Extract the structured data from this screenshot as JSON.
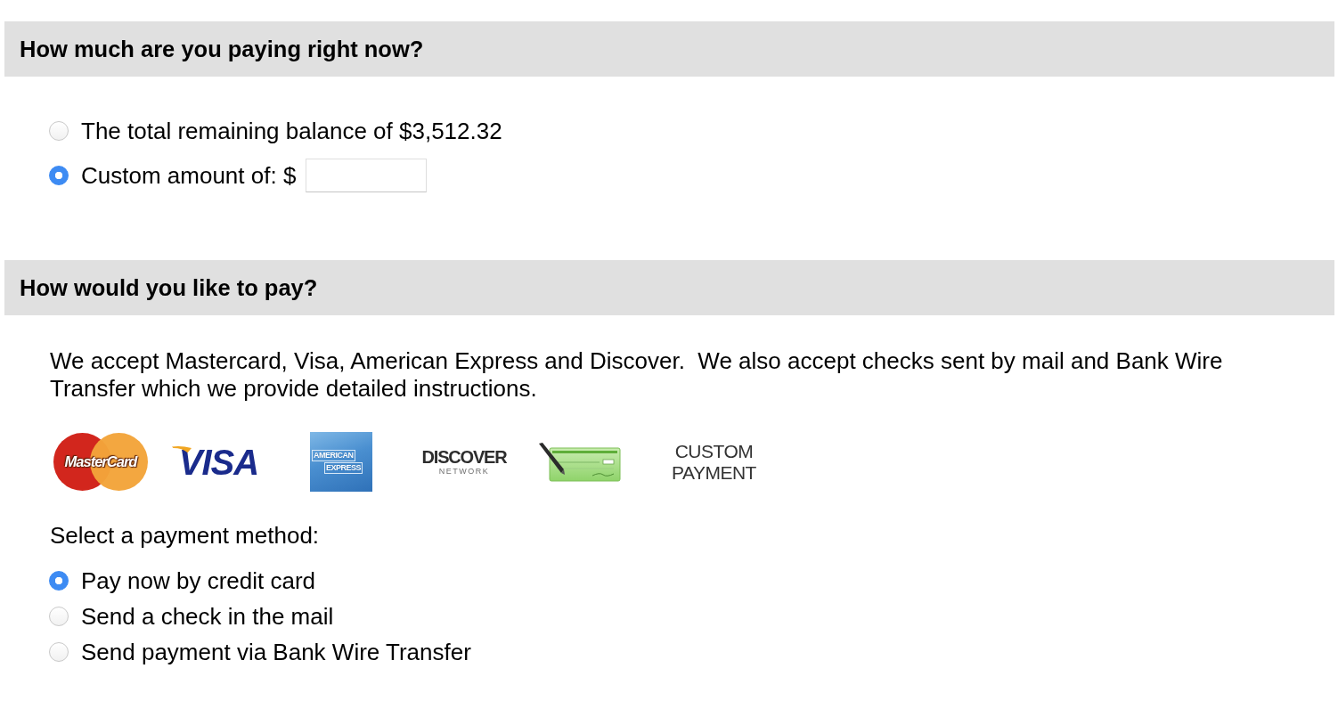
{
  "amount_section": {
    "heading": "How much are you paying right now?",
    "options": [
      {
        "kind": "plain",
        "label": "The total remaining balance of $3,512.32",
        "selected": false
      },
      {
        "kind": "amount-input",
        "label": "Custom amount of: $",
        "selected": true
      }
    ]
  },
  "payment_section": {
    "heading": "How would you like to pay?",
    "intro": "We accept Mastercard, Visa, American Express and Discover.  We also accept checks sent by mail and Bank Wire Transfer which we provide detailed instructions.",
    "logos": [
      {
        "kind": "mastercard",
        "lines": [
          "MasterCard"
        ]
      },
      {
        "kind": "visa",
        "lines": [
          "VISA"
        ]
      },
      {
        "kind": "amex",
        "lines": [
          "AMERICAN",
          "EXPRESS"
        ]
      },
      {
        "kind": "discover",
        "lines": [
          "DISCOVER",
          "NETWORK"
        ]
      },
      {
        "kind": "check"
      },
      {
        "kind": "custom",
        "lines": [
          "CUSTOM",
          "PAYMENT"
        ]
      }
    ],
    "prompt": "Select a payment method:",
    "options": [
      {
        "label": "Pay now by credit card",
        "selected": true
      },
      {
        "label": "Send a check in the mail",
        "selected": false
      },
      {
        "label": "Send payment via Bank Wire Transfer",
        "selected": false
      }
    ]
  }
}
